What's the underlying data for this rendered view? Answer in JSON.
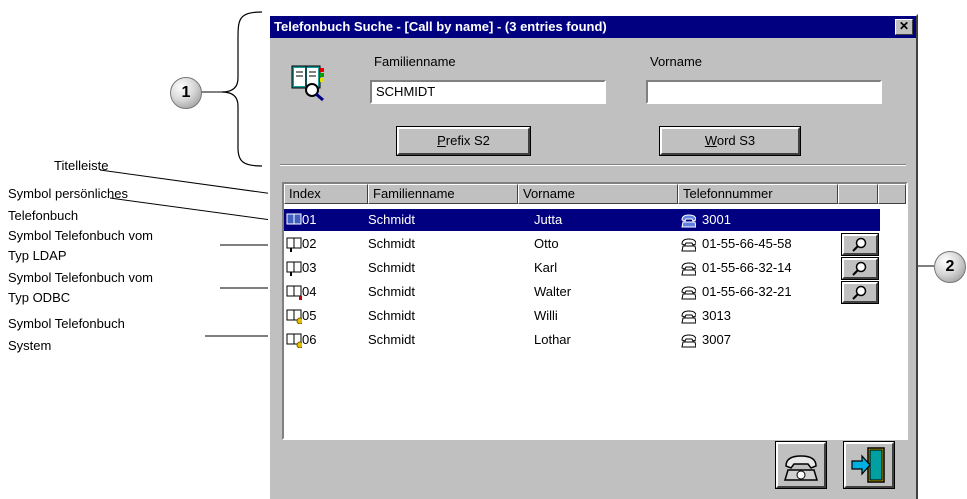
{
  "window": {
    "title": "Telefonbuch Suche - [Call by name] - (3 entries found)",
    "close_label": "✕"
  },
  "search": {
    "familienname_label": "Familienname",
    "familienname_value": "SCHMIDT",
    "vorname_label": "Vorname",
    "vorname_value": "",
    "prefix_button": {
      "accel": "P",
      "rest": "refix S2"
    },
    "word_button": {
      "accel": "W",
      "rest": "ord S3"
    }
  },
  "table": {
    "columns": [
      "Index",
      "Familienname",
      "Vorname",
      "Telefonnummer",
      ""
    ],
    "rows": [
      {
        "index": "01",
        "familienname": "Schmidt",
        "vorname": "Jutta",
        "telefon": "3001",
        "type": "personal",
        "selected": true,
        "lookup": false
      },
      {
        "index": "02",
        "familienname": "Schmidt",
        "vorname": "Otto",
        "telefon": "01-55-66-45-58",
        "type": "ldap",
        "selected": false,
        "lookup": true
      },
      {
        "index": "03",
        "familienname": "Schmidt",
        "vorname": "Karl",
        "telefon": "01-55-66-32-14",
        "type": "ldap",
        "selected": false,
        "lookup": true
      },
      {
        "index": "04",
        "familienname": "Schmidt",
        "vorname": "Walter",
        "telefon": "01-55-66-32-21",
        "type": "odbc",
        "selected": false,
        "lookup": true
      },
      {
        "index": "05",
        "familienname": "Schmidt",
        "vorname": "Willi",
        "telefon": "3013",
        "type": "system",
        "selected": false,
        "lookup": false
      },
      {
        "index": "06",
        "familienname": "Schmidt",
        "vorname": "Lothar",
        "telefon": "3007",
        "type": "system",
        "selected": false,
        "lookup": false
      }
    ]
  },
  "annotations": {
    "titelleiste": "Titelleiste",
    "symbol_persoenlich": [
      "Symbol persönliches",
      "Telefonbuch"
    ],
    "symbol_ldap": [
      "Symbol Telefonbuch vom",
      "Typ LDAP"
    ],
    "symbol_odbc": [
      "Symbol Telefonbuch vom",
      "Typ ODBC"
    ],
    "symbol_system": [
      "Symbol Telefonbuch",
      "System"
    ],
    "callout_1": "1",
    "callout_2": "2"
  },
  "icons": {
    "phonebook": "phonebook-search-icon",
    "phone": "telephone-icon",
    "lookup": "magnifier-icon",
    "dial": "dial-phone-icon",
    "exit": "exit-door-icon"
  },
  "colors": {
    "selection": "#000080",
    "titlebar": "#000080",
    "face": "#c0c0c0"
  }
}
